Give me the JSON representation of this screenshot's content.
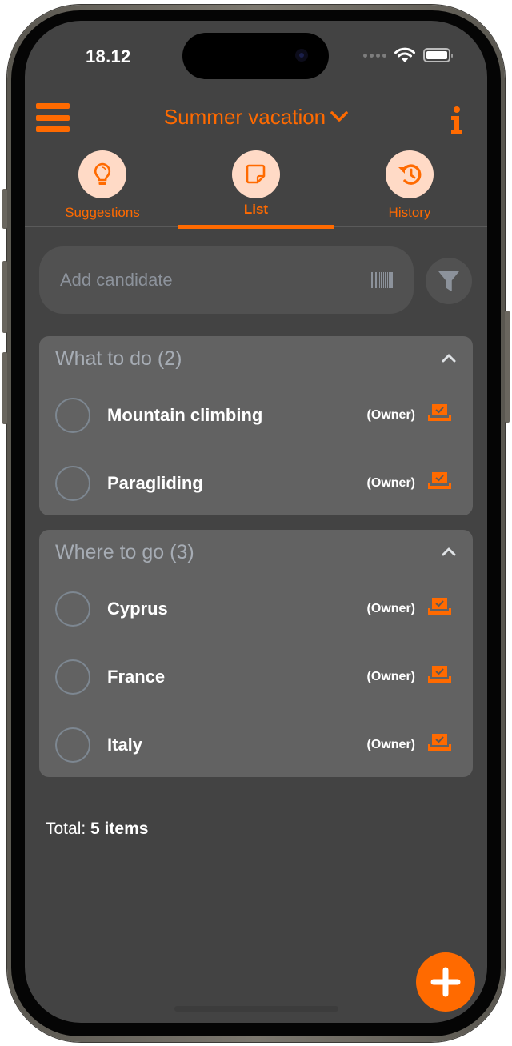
{
  "status_bar": {
    "time": "18.12"
  },
  "header": {
    "title": "Summer vacation",
    "menu_icon": "hamburger-menu-icon",
    "info_icon": "info-icon",
    "dropdown_icon": "chevron-down-icon"
  },
  "tabs": [
    {
      "label": "Suggestions",
      "icon": "lightbulb-icon",
      "active": false
    },
    {
      "label": "List",
      "icon": "note-icon",
      "active": true
    },
    {
      "label": "History",
      "icon": "history-icon",
      "active": false
    }
  ],
  "add_candidate": {
    "placeholder": "Add candidate",
    "value": "",
    "barcode_icon": "barcode-icon"
  },
  "filter": {
    "icon": "filter-icon"
  },
  "groups": [
    {
      "title": "What to do (2)",
      "expanded": true,
      "items": [
        {
          "name": "Mountain climbing",
          "role": "(Owner)"
        },
        {
          "name": "Paragliding",
          "role": "(Owner)"
        }
      ]
    },
    {
      "title": "Where to go (3)",
      "expanded": true,
      "items": [
        {
          "name": "Cyprus",
          "role": "(Owner)"
        },
        {
          "name": "France",
          "role": "(Owner)"
        },
        {
          "name": "Italy",
          "role": "(Owner)"
        }
      ]
    }
  ],
  "total": {
    "label": "Total:",
    "value": "5 items"
  },
  "fab": {
    "icon": "plus-icon"
  },
  "colors": {
    "accent": "#ff6a00",
    "tab_circle": "#ffdac6",
    "background": "#434343",
    "card": "#626262"
  }
}
